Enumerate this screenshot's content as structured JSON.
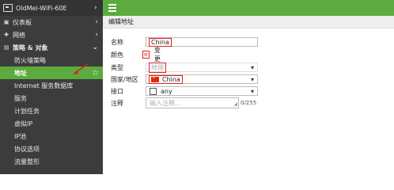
{
  "device": {
    "name": "OldMei-WiFi-60E"
  },
  "sidebar": {
    "items": [
      {
        "label": "仪表板",
        "icon": "dashboard-icon",
        "glyph": "▣"
      },
      {
        "label": "网络",
        "icon": "network-icon",
        "glyph": "✚"
      },
      {
        "label": "策略 & 对象",
        "icon": "policy-icon",
        "glyph": "▤"
      }
    ],
    "sub_items": [
      {
        "label": "防火墙策略"
      },
      {
        "label": "地址",
        "active": true
      },
      {
        "label": "Internet 服务数据库"
      },
      {
        "label": "服务"
      },
      {
        "label": "计划任务"
      },
      {
        "label": "虚拟IP"
      },
      {
        "label": "IP池"
      },
      {
        "label": "协议选项"
      },
      {
        "label": "流量整形"
      }
    ]
  },
  "breadcrumb": "编辑地址",
  "form": {
    "name_label": "名称",
    "name_value": "China",
    "color_label": "颜色",
    "color_change": "变更",
    "type_label": "类型",
    "type_value": "地理",
    "country_label": "国家/地区",
    "country_value": "China",
    "interface_label": "接口",
    "interface_value": "any",
    "comment_label": "注释",
    "comment_placeholder": "输入注释...",
    "comment_counter": "0/255"
  },
  "colors": {
    "accent": "#5bab3e",
    "highlight": "#e02020",
    "sidebar": "#3c3c3c"
  }
}
